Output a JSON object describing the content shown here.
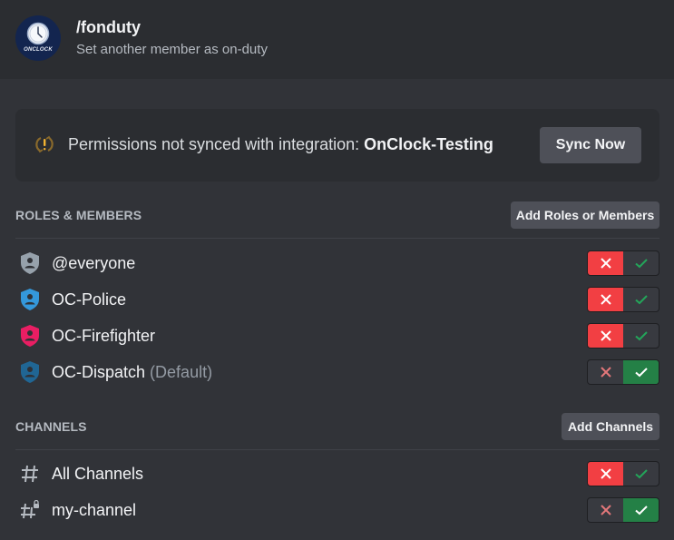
{
  "header": {
    "avatar_text": "ONCLOCK",
    "command": "/fonduty",
    "description": "Set another member as on-duty"
  },
  "banner": {
    "icon": "sync-warning-icon",
    "message": "Permissions not synced with integration:",
    "integration": "OnClock-Testing",
    "button": "Sync Now"
  },
  "roles_section": {
    "title": "ROLES & MEMBERS",
    "add_button": "Add Roles or Members",
    "items": [
      {
        "name": "@everyone",
        "suffix": "",
        "icon_color": "#96a1ab",
        "state": "deny"
      },
      {
        "name": "OC-Police",
        "suffix": "",
        "icon_color": "#3498db",
        "state": "deny"
      },
      {
        "name": "OC-Firefighter",
        "suffix": "",
        "icon_color": "#e91e63",
        "state": "deny"
      },
      {
        "name": "OC-Dispatch",
        "suffix": "(Default)",
        "icon_color": "#206694",
        "state": "allow"
      }
    ]
  },
  "channels_section": {
    "title": "CHANNELS",
    "add_button": "Add Channels",
    "items": [
      {
        "name": "All Channels",
        "icon": "hashtag-icon",
        "state": "deny"
      },
      {
        "name": "my-channel",
        "icon": "hashtag-lock-icon",
        "state": "allow"
      }
    ]
  },
  "colors": {
    "deny": "#f23f43",
    "allow": "#248046",
    "warning": "#c08a2a"
  }
}
